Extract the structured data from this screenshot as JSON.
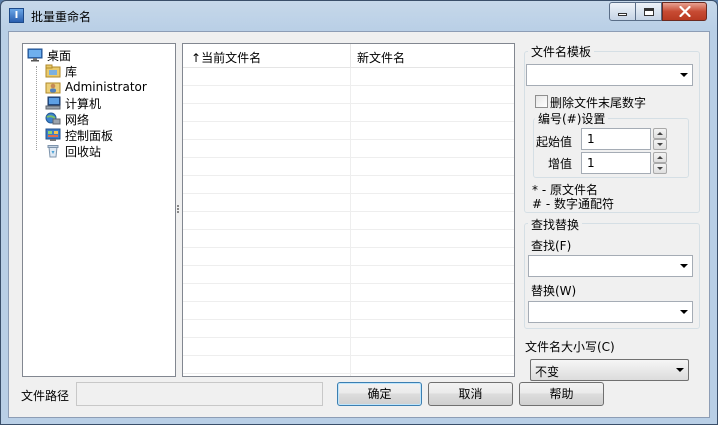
{
  "window": {
    "title": "批量重命名"
  },
  "tree": {
    "root": {
      "label": "桌面",
      "icon": "desktop-icon"
    },
    "items": [
      {
        "label": "库",
        "icon": "library-icon"
      },
      {
        "label": "Administrator",
        "icon": "user-folder-icon"
      },
      {
        "label": "计算机",
        "icon": "computer-icon"
      },
      {
        "label": "网络",
        "icon": "network-icon"
      },
      {
        "label": "控制面板",
        "icon": "control-panel-icon"
      },
      {
        "label": "回收站",
        "icon": "recycle-bin-icon"
      }
    ]
  },
  "list": {
    "columns": [
      {
        "label": "当前文件名",
        "sort_indicator": "↑"
      },
      {
        "label": "新文件名"
      }
    ],
    "rows": []
  },
  "template": {
    "group_label": "文件名模板",
    "value": "",
    "delete_trailing_digits_label": "删除文件末尾数字",
    "delete_trailing_digits_checked": false
  },
  "numbering": {
    "group_label": "编号(#)设置",
    "start_label": "起始值",
    "start_value": "1",
    "step_label": "增值",
    "step_value": "1"
  },
  "legend": {
    "original_name": "* - 原文件名",
    "digit_wildcard": "# - 数字通配符"
  },
  "find_replace": {
    "group_label": "查找替换",
    "find_label": "查找(F)",
    "find_value": "",
    "replace_label": "替换(W)",
    "replace_value": ""
  },
  "case": {
    "label": "文件名大小写(C)",
    "selected": "不变"
  },
  "footer": {
    "path_label": "文件路径",
    "path_value": "",
    "ok_label": "确定",
    "cancel_label": "取消",
    "help_label": "帮助"
  },
  "colors": {
    "title_bar": "#b9cfe6",
    "close_button": "#c74b33",
    "default_button_border": "#3c7fb1"
  }
}
